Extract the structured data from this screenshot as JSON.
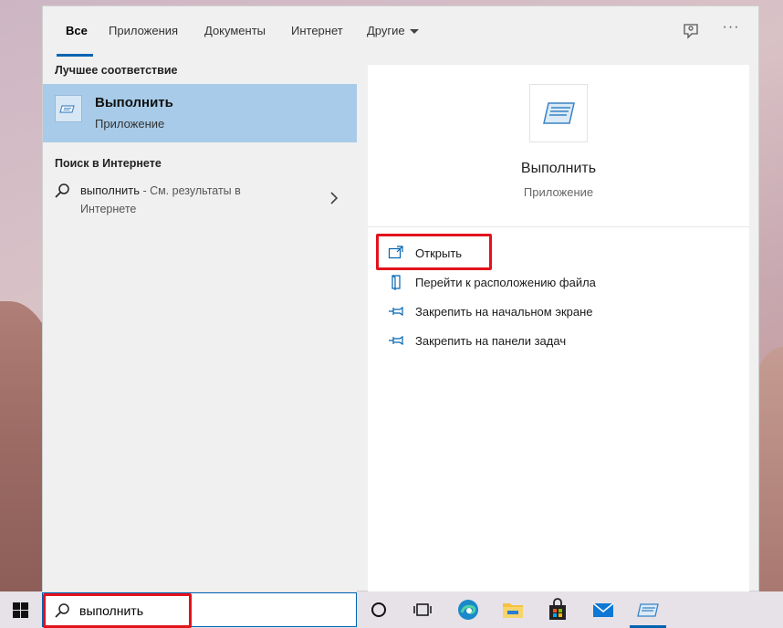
{
  "tabs": {
    "all": "Все",
    "apps": "Приложения",
    "documents": "Документы",
    "web": "Интернет",
    "more": "Другие"
  },
  "left": {
    "best_match_title": "Лучшее соответствие",
    "best_match": {
      "name": "Выполнить",
      "type": "Приложение"
    },
    "web_title": "Поиск в Интернете",
    "web_result": {
      "query": "выполнить",
      "hint": " - См. результаты в",
      "hint_line2": "Интернете"
    }
  },
  "preview": {
    "name": "Выполнить",
    "type": "Приложение",
    "actions": {
      "open": "Открыть",
      "file_location": "Перейти к расположению файла",
      "pin_start": "Закрепить на начальном экране",
      "pin_taskbar": "Закрепить на панели задач"
    }
  },
  "search": {
    "value": "выполнить"
  },
  "colors": {
    "accent": "#0063b1",
    "selection": "#a7cbe8",
    "highlight": "#e2131c"
  },
  "icons": [
    "feedback-icon",
    "more-icon",
    "run-app-icon",
    "search-icon",
    "chevron-right-icon",
    "open-icon",
    "folder-icon",
    "pin-icon",
    "windows-logo-icon",
    "cortana-icon",
    "task-view-icon",
    "edge-icon",
    "file-explorer-icon",
    "store-icon",
    "mail-icon"
  ]
}
